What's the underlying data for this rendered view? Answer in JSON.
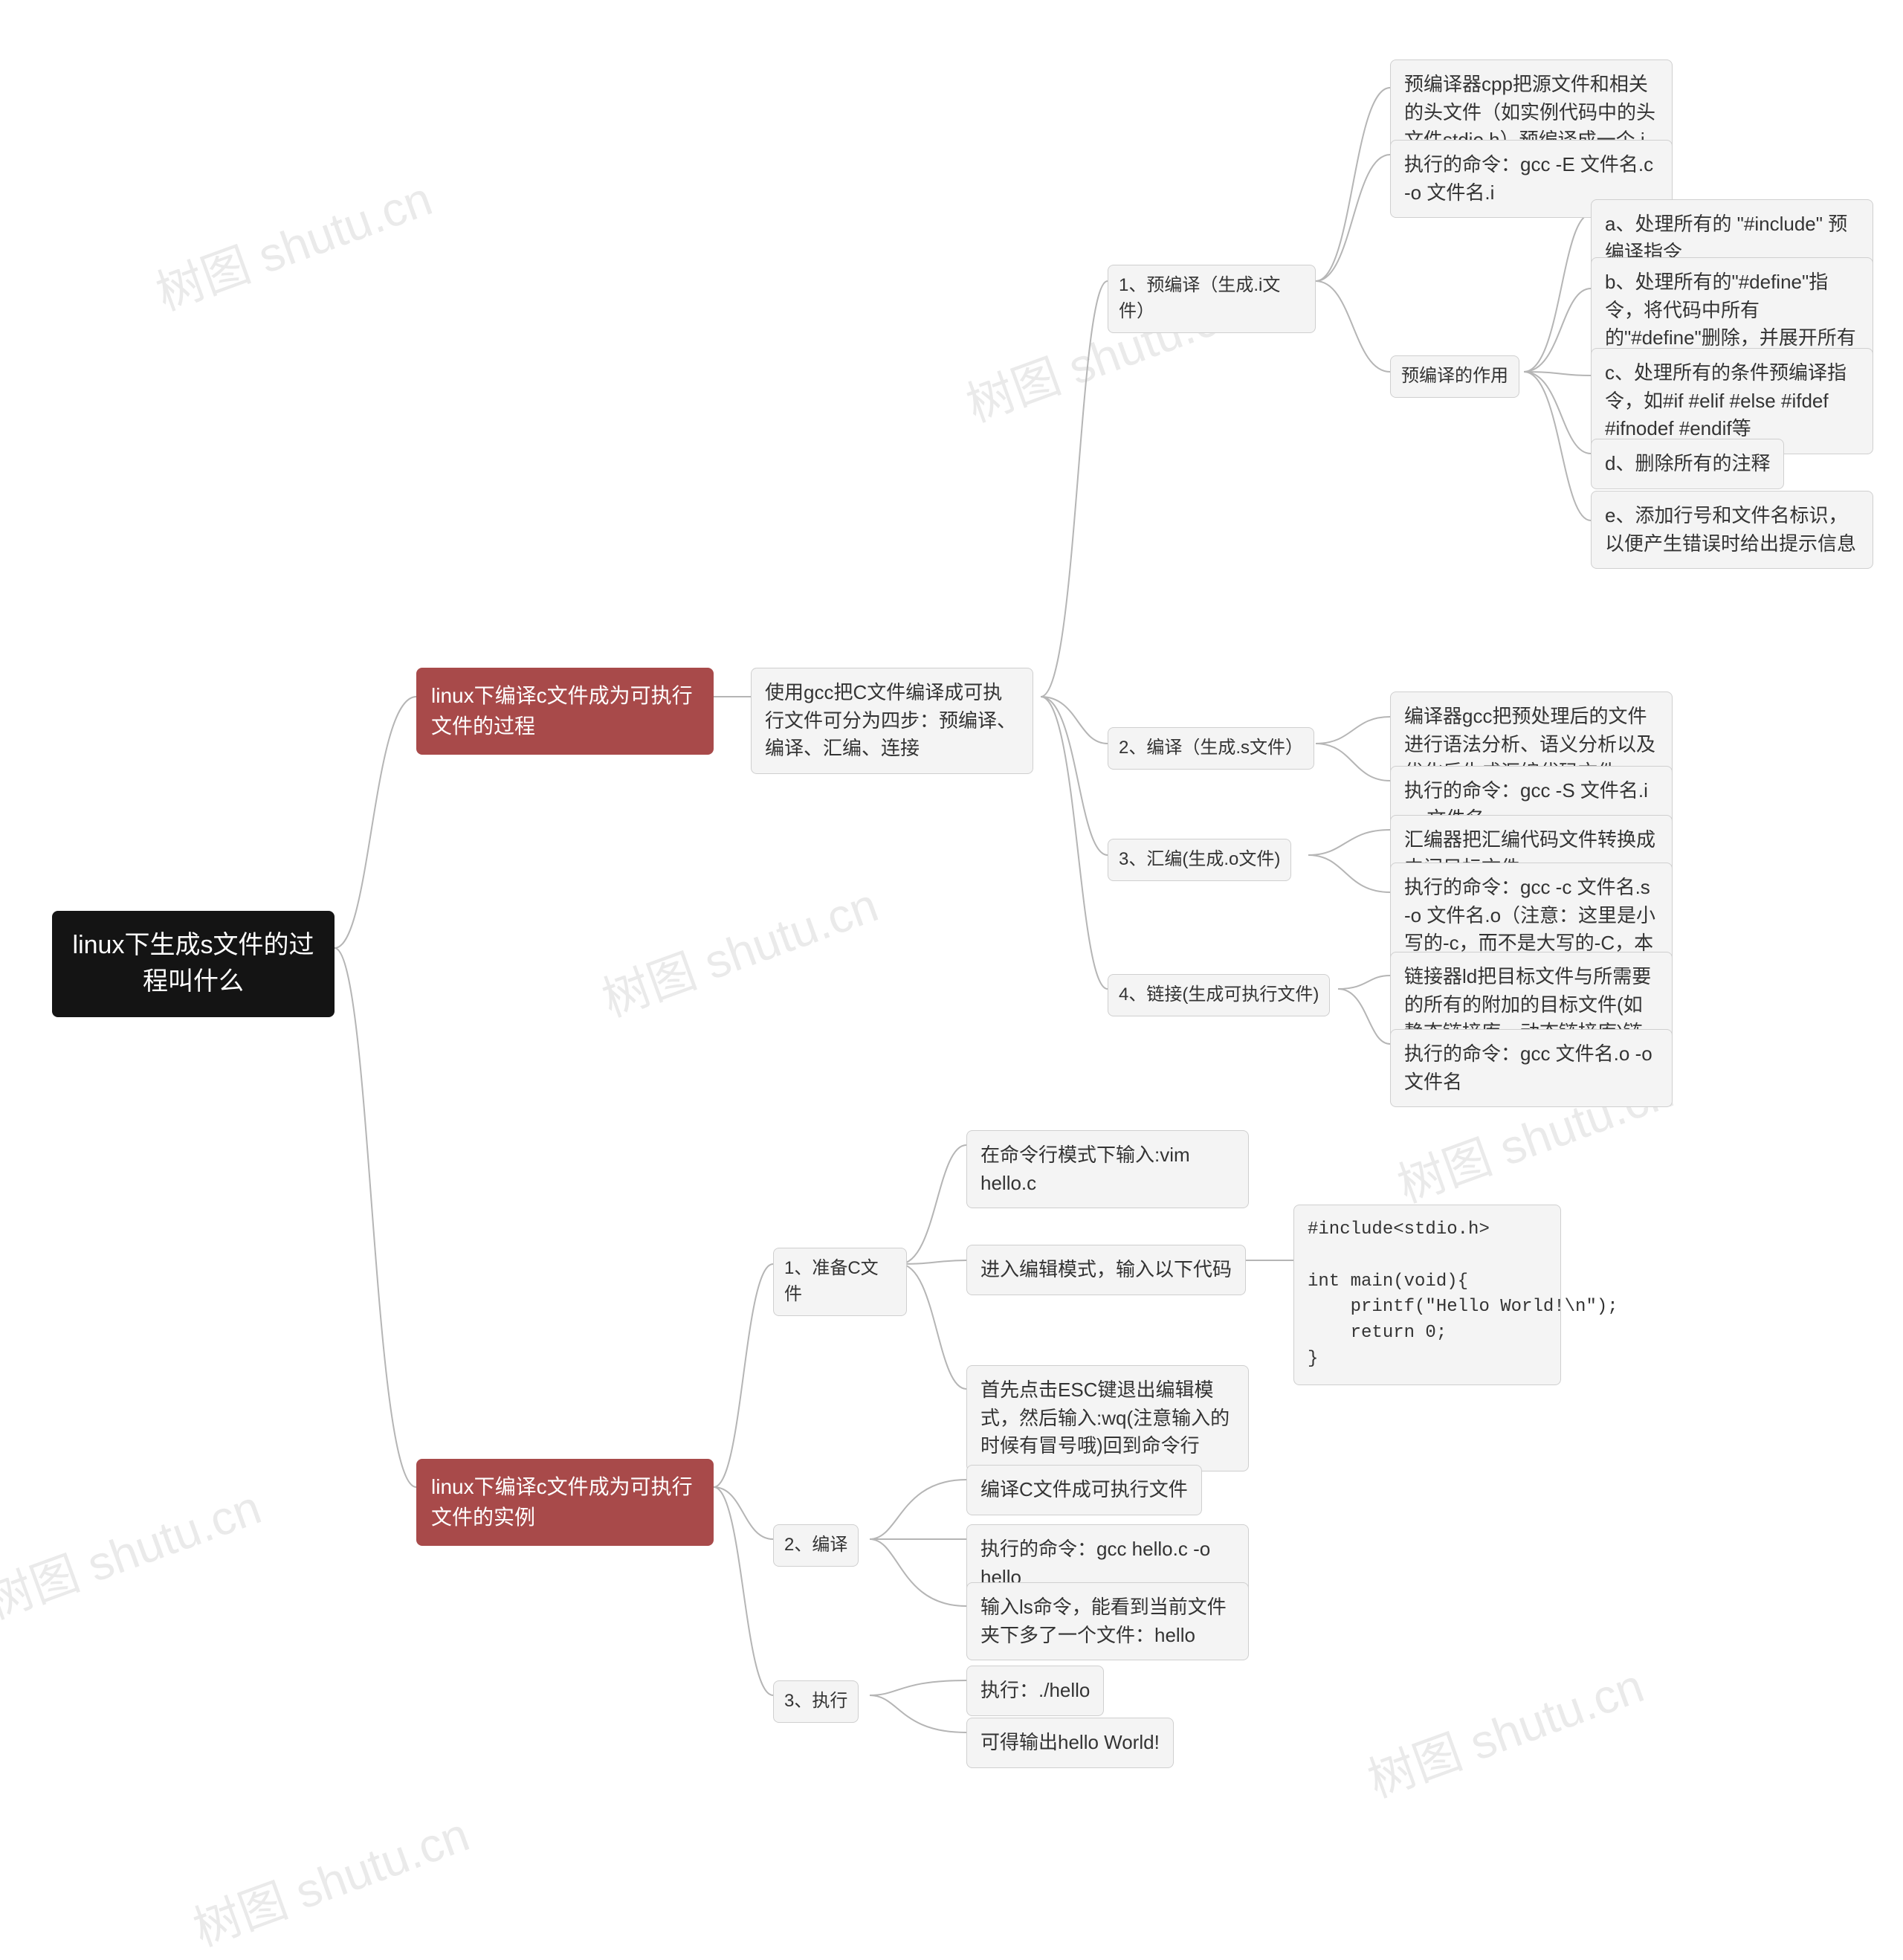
{
  "watermark": "树图 shutu.cn",
  "root": "linux下生成s文件的过程叫什么",
  "branch1": "linux下编译c文件成为可执行文件的过程",
  "branch1_desc": "使用gcc把C文件编译成可执行文件可分为四步：预编译、编译、汇编、连接",
  "step1": {
    "title": "1、预编译（生成.i文件）"
  },
  "s1_desc": "预编译器cpp把源文件和相关的头文件（如实例代码中的头文件stdio.h）预编译成一个.i的文件",
  "s1_cmd": "执行的命令：gcc -E 文件名.c -o 文件名.i",
  "s1_role": "预编译的作用",
  "s1_a": "a、处理所有的 \"#include\" 预编译指令",
  "s1_b": "b、处理所有的\"#define\"指令，将代码中所有的\"#define\"删除，并展开所有的宏定义",
  "s1_c": "c、处理所有的条件预编译指令，如#if #elif #else #ifdef #ifnodef #endif等",
  "s1_d": "d、删除所有的注释",
  "s1_e": "e、添加行号和文件名标识，以便产生错误时给出提示信息",
  "step2": {
    "title": "2、编译（生成.s文件）"
  },
  "s2_desc": "编译器gcc把预处理后的文件进行语法分析、语义分析以及优化后生成汇编代码文件",
  "s2_cmd": "执行的命令：gcc -S 文件名.i -o 文件名.s",
  "step3": {
    "title": "3、汇编(生成.o文件)"
  },
  "s3_desc": "汇编器把汇编代码文件转换成中间目标文件",
  "s3_cmd": "执行的命令：gcc -c 文件名.s -o 文件名.o（注意：这里是小写的-c，而不是大写的-C，本人在此处踩坑，出现异常）",
  "step4": {
    "title": "4、链接(生成可执行文件)"
  },
  "s4_desc": "链接器ld把目标文件与所需要的所有的附加的目标文件(如静态链接库、动态链接库)链接起来成为可执行的文件",
  "s4_cmd": "执行的命令：gcc 文件名.o -o 文件名",
  "branch2": "linux下编译c文件成为可执行文件的实例",
  "ex1": {
    "title": "1、准备C文件"
  },
  "ex1_a": "在命令行模式下输入:vim hello.c",
  "ex1_b": "进入编辑模式，输入以下代码",
  "ex1_code": "#include<stdio.h>\n\nint main(void){\n    printf(\"Hello World!\\n\");\n    return 0;\n}",
  "ex1_c": "首先点击ESC键退出编辑模式，然后输入:wq(注意输入的时候有冒号哦)回到命令行",
  "ex2": {
    "title": "2、编译"
  },
  "ex2_a": "编译C文件成可执行文件",
  "ex2_b": "执行的命令：gcc hello.c -o hello",
  "ex2_c": "输入ls命令，能看到当前文件夹下多了一个文件：hello",
  "ex3": {
    "title": "3、执行"
  },
  "ex3_a": "执行：./hello",
  "ex3_b": "可得输出hello World!"
}
